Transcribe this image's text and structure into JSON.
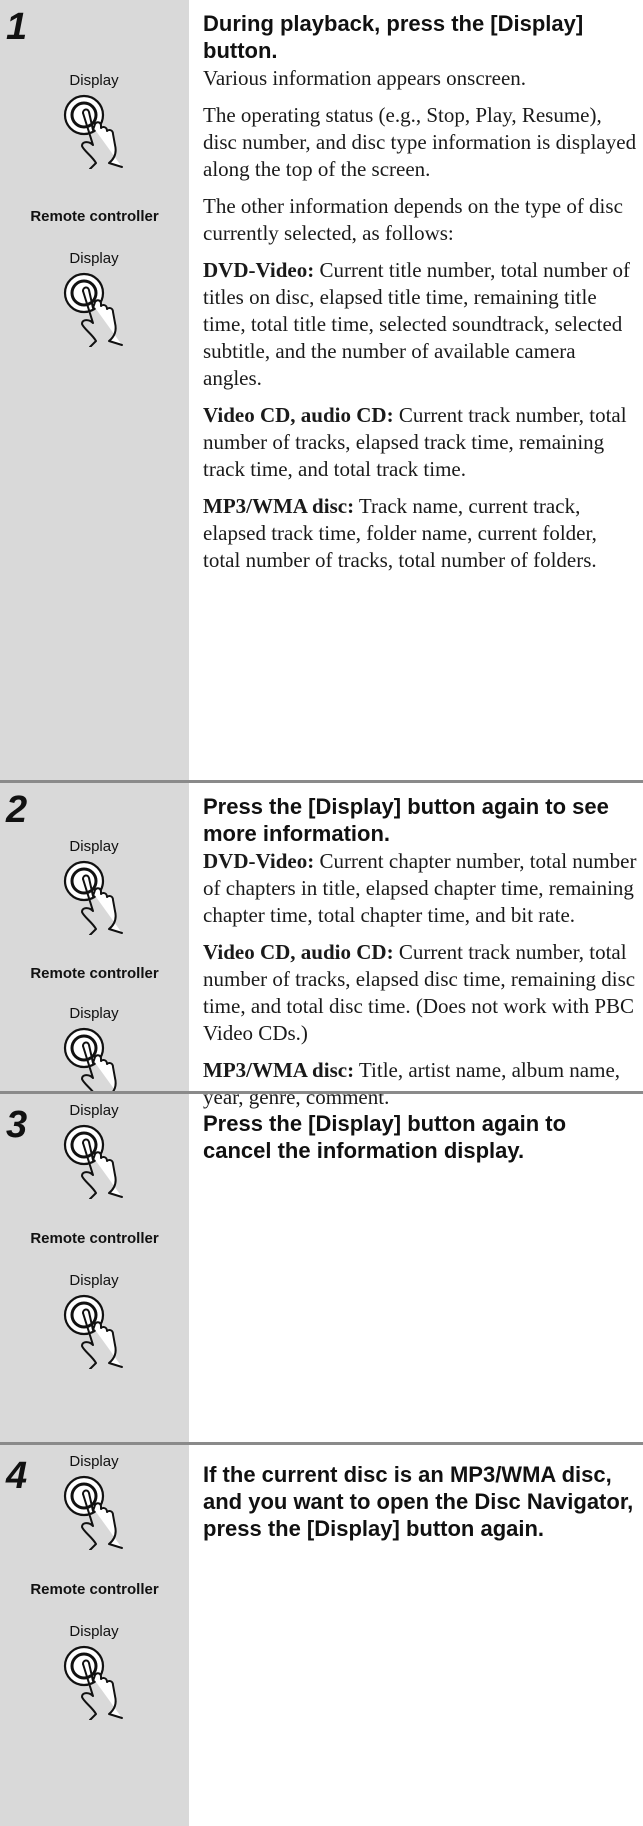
{
  "icons": {
    "display_label": "Display",
    "remote_label": "Remote controller",
    "icon_name": "press-button-icon"
  },
  "steps": [
    {
      "number": "1",
      "heading": "During playback, press the [Display] button.",
      "paragraphs": [
        {
          "bold": "",
          "text": "Various information appears onscreen."
        },
        {
          "bold": "",
          "text": "The operating status (e.g., Stop, Play, Resume), disc number, and disc type information is displayed along the top of the screen."
        },
        {
          "bold": "",
          "text": "The other information depends on the type of disc currently selected, as follows:"
        },
        {
          "bold": "DVD-Video:",
          "text": " Current title number, total number of titles on disc, elapsed title time, remaining title time, total title time, selected soundtrack, selected subtitle, and the number of available camera angles."
        },
        {
          "bold": "Video CD, audio CD:",
          "text": " Current track number, total number of tracks, elapsed track time, remaining track time, and total track time."
        },
        {
          "bold": "MP3/WMA disc:",
          "text": " Track name, current track, elapsed track time, folder name, current folder, total number of tracks, total number of folders."
        }
      ]
    },
    {
      "number": "2",
      "heading": "Press the [Display] button again to see more information.",
      "paragraphs": [
        {
          "bold": "DVD-Video:",
          "text": " Current chapter number, total number of chapters in title, elapsed chapter time, remaining chapter time, total chapter time, and bit rate."
        },
        {
          "bold": "Video CD, audio CD:",
          "text": " Current track number, total number of tracks, elapsed disc time, remaining disc time, and total disc time. (Does not work with PBC Video CDs.)"
        },
        {
          "bold": "MP3/WMA disc:",
          "text": " Title, artist name, album name, year, genre, comment."
        }
      ]
    },
    {
      "number": "3",
      "heading": "Press the [Display] button again to cancel the information display.",
      "paragraphs": []
    },
    {
      "number": "4",
      "heading": "If the current disc is an MP3/WMA disc, and you want to open the Disc Navigator, press the [Display] button again.",
      "paragraphs": []
    }
  ]
}
